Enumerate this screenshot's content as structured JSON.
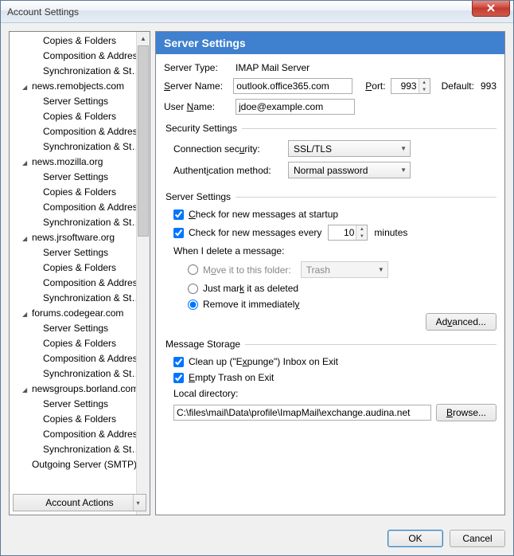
{
  "window": {
    "title": "Account Settings"
  },
  "sidebar": {
    "items": [
      {
        "type": "leaf",
        "label": "Copies & Folders"
      },
      {
        "type": "leaf",
        "label": "Composition & Addres..."
      },
      {
        "type": "leaf",
        "label": "Synchronization & Stor..."
      },
      {
        "type": "group",
        "label": "news.remobjects.com"
      },
      {
        "type": "leaf",
        "label": "Server Settings"
      },
      {
        "type": "leaf",
        "label": "Copies & Folders"
      },
      {
        "type": "leaf",
        "label": "Composition & Addres..."
      },
      {
        "type": "leaf",
        "label": "Synchronization & Stor..."
      },
      {
        "type": "group",
        "label": "news.mozilla.org"
      },
      {
        "type": "leaf",
        "label": "Server Settings"
      },
      {
        "type": "leaf",
        "label": "Copies & Folders"
      },
      {
        "type": "leaf",
        "label": "Composition & Addres..."
      },
      {
        "type": "leaf",
        "label": "Synchronization & Stor..."
      },
      {
        "type": "group",
        "label": "news.jrsoftware.org"
      },
      {
        "type": "leaf",
        "label": "Server Settings"
      },
      {
        "type": "leaf",
        "label": "Copies & Folders"
      },
      {
        "type": "leaf",
        "label": "Composition & Addres..."
      },
      {
        "type": "leaf",
        "label": "Synchronization & Stor..."
      },
      {
        "type": "group",
        "label": "forums.codegear.com"
      },
      {
        "type": "leaf",
        "label": "Server Settings"
      },
      {
        "type": "leaf",
        "label": "Copies & Folders"
      },
      {
        "type": "leaf",
        "label": "Composition & Addres..."
      },
      {
        "type": "leaf",
        "label": "Synchronization & Stor..."
      },
      {
        "type": "group",
        "label": "newsgroups.borland.com"
      },
      {
        "type": "leaf",
        "label": "Server Settings"
      },
      {
        "type": "leaf",
        "label": "Copies & Folders"
      },
      {
        "type": "leaf",
        "label": "Composition & Addres..."
      },
      {
        "type": "leaf",
        "label": "Synchronization & Stor..."
      },
      {
        "type": "leaf-top",
        "label": "Outgoing Server (SMTP)"
      }
    ],
    "account_actions": "Account Actions"
  },
  "panel": {
    "header": "Server Settings",
    "server_type_label": "Server Type:",
    "server_type_value": "IMAP Mail Server",
    "server_name_label": "Server Name:",
    "server_name_value": "outlook.office365.com",
    "port_label": "Port:",
    "port_value": "993",
    "default_label": "Default:",
    "default_value": "993",
    "user_name_label": "User Name:",
    "user_name_value": "jdoe@example.com",
    "security": {
      "legend": "Security Settings",
      "conn_sec_label": "Connection security:",
      "conn_sec_value": "SSL/TLS",
      "auth_label": "Authentication method:",
      "auth_value": "Normal password"
    },
    "server": {
      "legend": "Server Settings",
      "check_startup": "Check for new messages at startup",
      "check_startup_checked": true,
      "check_every_prefix": "Check for new messages every",
      "check_every_value": "10",
      "check_every_suffix": "minutes",
      "check_every_checked": true,
      "when_delete": "When I delete a message:",
      "move_it": "Move it to this folder:",
      "move_folder": "Trash",
      "just_mark": "Just mark it as deleted",
      "remove_imm": "Remove it immediately",
      "delete_selected": "remove",
      "advanced_btn": "Advanced..."
    },
    "storage": {
      "legend": "Message Storage",
      "expunge": "Clean up (\"Expunge\") Inbox on Exit",
      "expunge_checked": true,
      "empty_trash": "Empty Trash on Exit",
      "empty_trash_checked": true,
      "local_dir_label": "Local directory:",
      "local_dir_value": "C:\\files\\mail\\Data\\profile\\ImapMail\\exchange.audina.net",
      "browse_btn": "Browse..."
    }
  },
  "footer": {
    "ok": "OK",
    "cancel": "Cancel"
  }
}
